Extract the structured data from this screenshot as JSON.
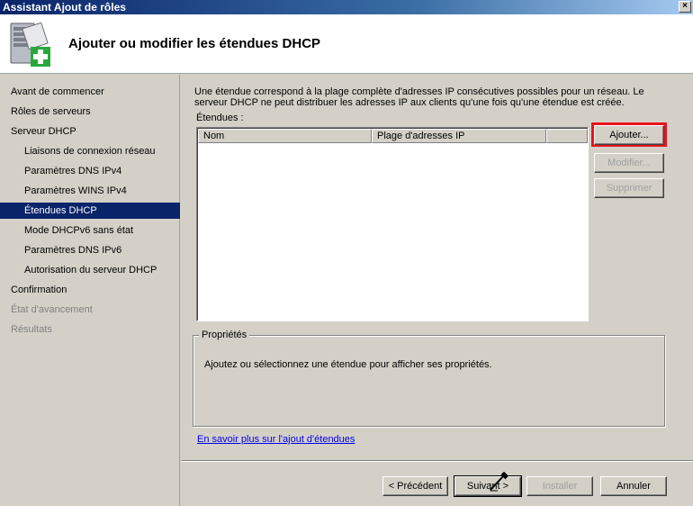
{
  "window": {
    "title": "Assistant Ajout de rôles",
    "close_glyph": "×"
  },
  "header": {
    "title": "Ajouter ou modifier les étendues DHCP",
    "icon": "server-add-icon"
  },
  "sidebar": {
    "items": [
      {
        "label": "Avant de commencer"
      },
      {
        "label": "Rôles de serveurs"
      },
      {
        "label": "Serveur DHCP"
      },
      {
        "label": "Liaisons de connexion réseau"
      },
      {
        "label": "Paramètres DNS IPv4"
      },
      {
        "label": "Paramètres WINS IPv4"
      },
      {
        "label": "Étendues DHCP"
      },
      {
        "label": "Mode DHCPv6 sans état"
      },
      {
        "label": "Paramètres DNS IPv6"
      },
      {
        "label": "Autorisation du serveur DHCP"
      },
      {
        "label": "Confirmation"
      },
      {
        "label": "État d'avancement"
      },
      {
        "label": "Résultats"
      }
    ],
    "selected_index": 6
  },
  "main": {
    "description": "Une étendue correspond à la plage complète d'adresses IP consécutives possibles pour un réseau. Le serveur DHCP ne peut distribuer les adresses IP aux clients qu'une fois qu'une étendue est créée.",
    "scopes_label": "Étendues :",
    "columns": [
      "Nom",
      "Plage d'adresses IP",
      ""
    ],
    "buttons": {
      "add": "Ajouter...",
      "modify": "Modifier...",
      "delete": "Supprimer"
    },
    "properties": {
      "title": "Propriétés",
      "text": "Ajoutez ou sélectionnez une étendue pour afficher ses propriétés."
    },
    "link": "En savoir plus sur l'ajout d'étendues"
  },
  "footer": {
    "previous": "< Précédent",
    "next": "Suivant >",
    "install": "Installer",
    "cancel": "Annuler"
  },
  "colors": {
    "highlight": "#e8141c",
    "selected": "#0a246a",
    "link": "#0000ee"
  }
}
